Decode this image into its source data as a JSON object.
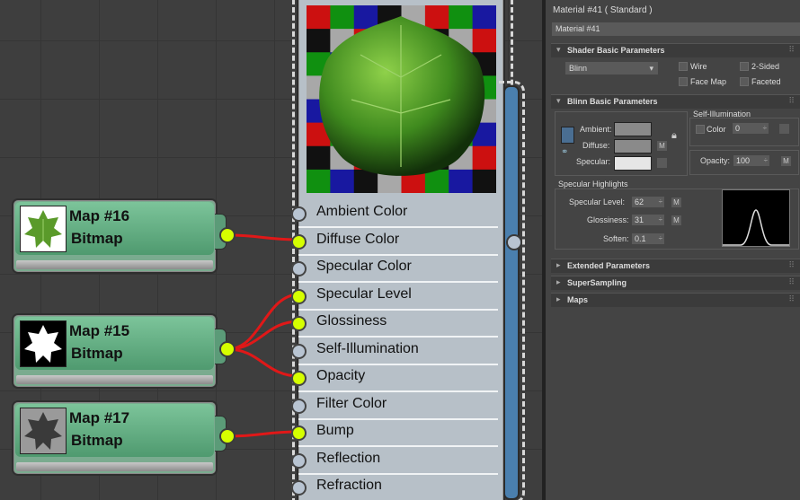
{
  "nodes": [
    {
      "title": "Map #16",
      "type": "Bitmap",
      "thumb": "leaf-color-icon"
    },
    {
      "title": "Map #15",
      "type": "Bitmap",
      "thumb": "leaf-mask-icon"
    },
    {
      "title": "Map #17",
      "type": "Bitmap",
      "thumb": "leaf-bump-icon"
    }
  ],
  "slots": [
    {
      "label": "Ambient Color",
      "connected": false
    },
    {
      "label": "Diffuse Color",
      "connected": true
    },
    {
      "label": "Specular Color",
      "connected": false
    },
    {
      "label": "Specular Level",
      "connected": true
    },
    {
      "label": "Glossiness",
      "connected": true
    },
    {
      "label": "Self-Illumination",
      "connected": false
    },
    {
      "label": "Opacity",
      "connected": true
    },
    {
      "label": "Filter Color",
      "connected": false
    },
    {
      "label": "Bump",
      "connected": true
    },
    {
      "label": "Reflection",
      "connected": false
    },
    {
      "label": "Refraction",
      "connected": false
    }
  ],
  "panel": {
    "title": "Material #41  ( Standard )",
    "name_value": "Material #41",
    "shader_rollout": "Shader Basic Parameters",
    "shader": "Blinn",
    "wire": "Wire",
    "two_sided": "2-Sided",
    "face_map": "Face Map",
    "faceted": "Faceted",
    "blinn_rollout": "Blinn Basic Parameters",
    "ambient": "Ambient:",
    "diffuse": "Diffuse:",
    "specular": "Specular:",
    "m": "M",
    "self_illum": "Self-Illumination",
    "color": "Color",
    "self_illum_value": "0",
    "opacity": "Opacity:",
    "opacity_value": "100",
    "spec_highlights": "Specular Highlights",
    "spec_level": "Specular Level:",
    "spec_level_value": "62",
    "glossiness": "Glossiness:",
    "glossiness_value": "31",
    "soften": "Soften:",
    "soften_value": "0.1",
    "extended": "Extended Parameters",
    "supersampling": "SuperSampling",
    "maps": "Maps"
  },
  "colors": {
    "node_green": "#5ea980",
    "socket_active": "#d6ff00",
    "wire": "#e01818",
    "output_bar": "#4a7fae"
  }
}
